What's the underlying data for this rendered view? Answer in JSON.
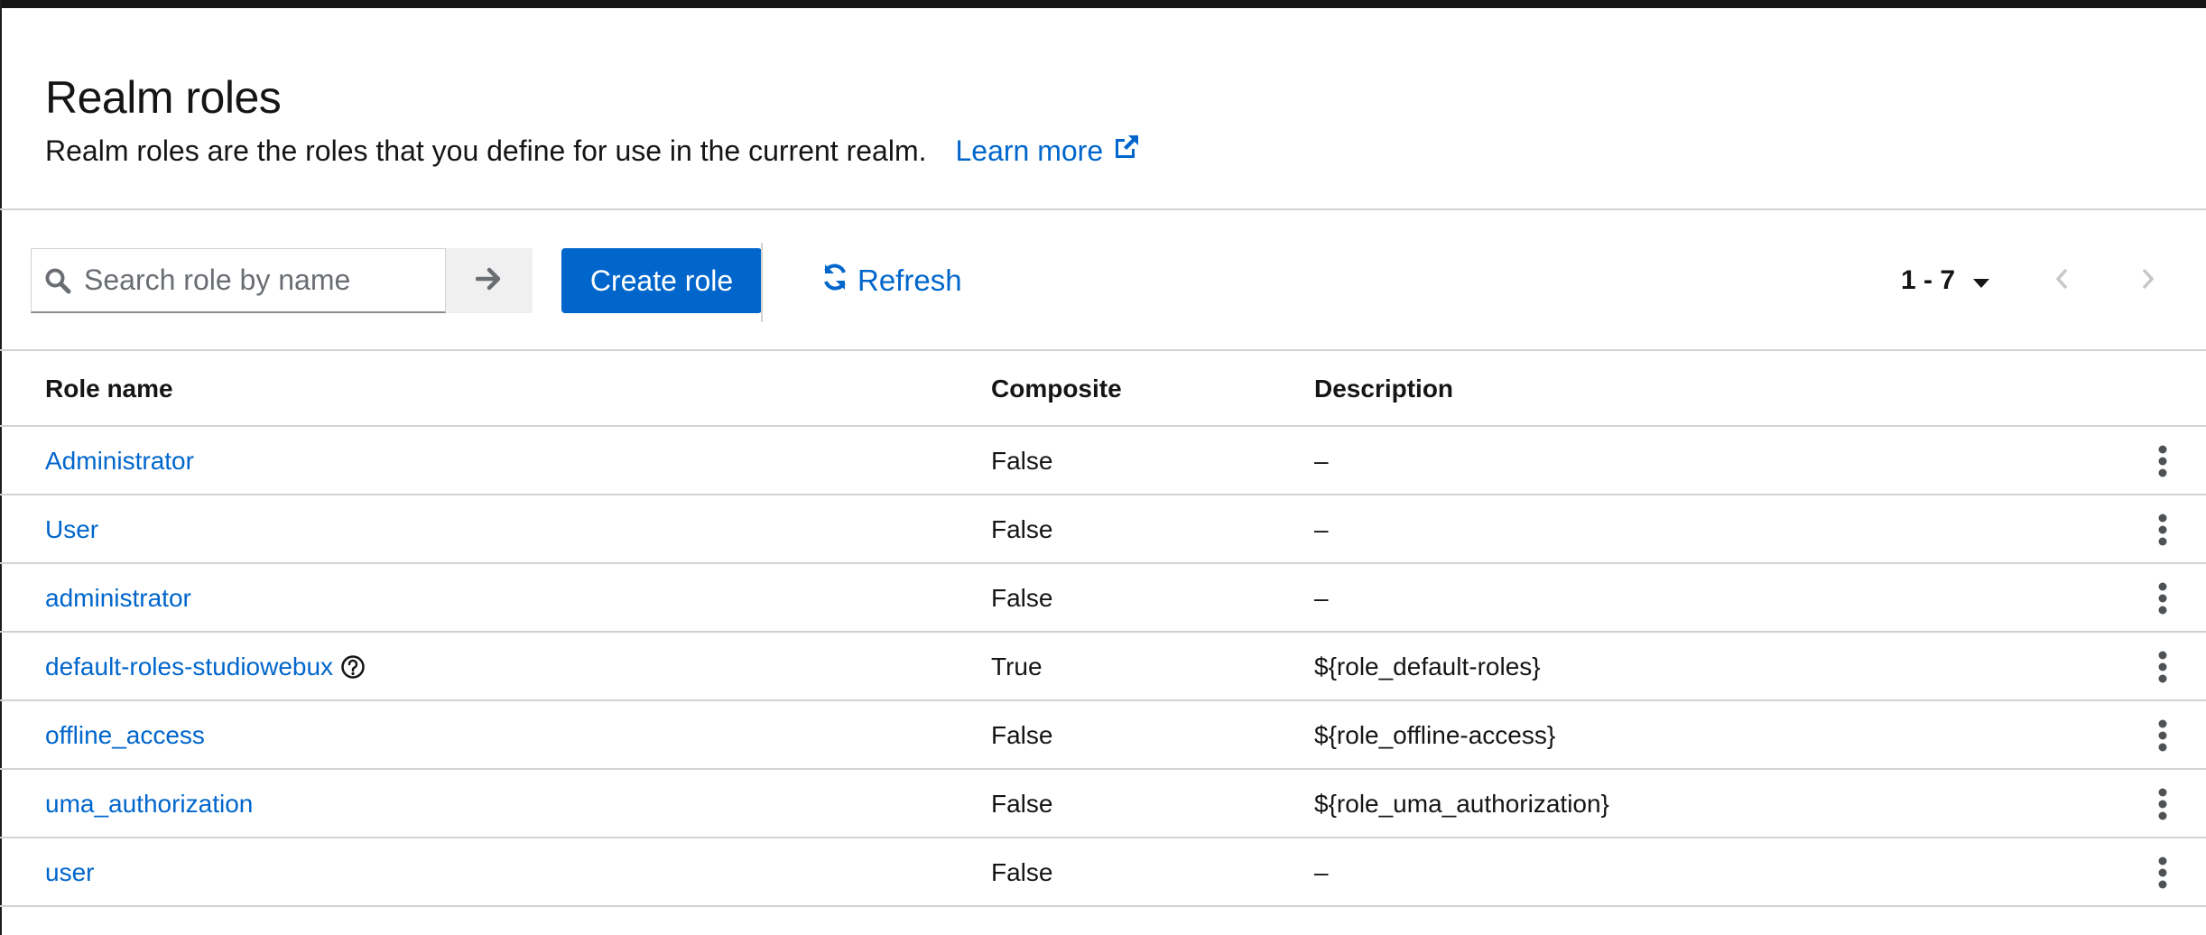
{
  "header": {
    "title": "Realm roles",
    "description": "Realm roles are the roles that you define for use in the current realm.",
    "learn_more": "Learn more"
  },
  "toolbar": {
    "search_placeholder": "Search role by name",
    "create_label": "Create role",
    "refresh_label": "Refresh",
    "pagination_label": "1 - 7"
  },
  "table": {
    "columns": [
      "Role name",
      "Composite",
      "Description"
    ],
    "rows": [
      {
        "name": "Administrator",
        "composite": "False",
        "description": "–"
      },
      {
        "name": "User",
        "composite": "False",
        "description": "–"
      },
      {
        "name": "administrator",
        "composite": "False",
        "description": "–"
      },
      {
        "name": "default-roles-studiowebux",
        "composite": "True",
        "description": "${role_default-roles}"
      },
      {
        "name": "offline_access",
        "composite": "False",
        "description": "${role_offline-access}"
      },
      {
        "name": "uma_authorization",
        "composite": "False",
        "description": "${role_uma_authorization}"
      },
      {
        "name": "user",
        "composite": "False",
        "description": "–"
      }
    ]
  },
  "icons": {
    "search": "search-icon",
    "arrow": "arrow-right-icon",
    "external": "external-link-icon",
    "refresh": "sync-icon",
    "caret": "caret-down-icon",
    "prev": "angle-left-icon",
    "next": "angle-right-icon",
    "kebab": "kebab-icon",
    "help": "help-icon"
  },
  "colors": {
    "accent": "#0066cc",
    "text": "#151515",
    "border": "#d2d2d2"
  }
}
